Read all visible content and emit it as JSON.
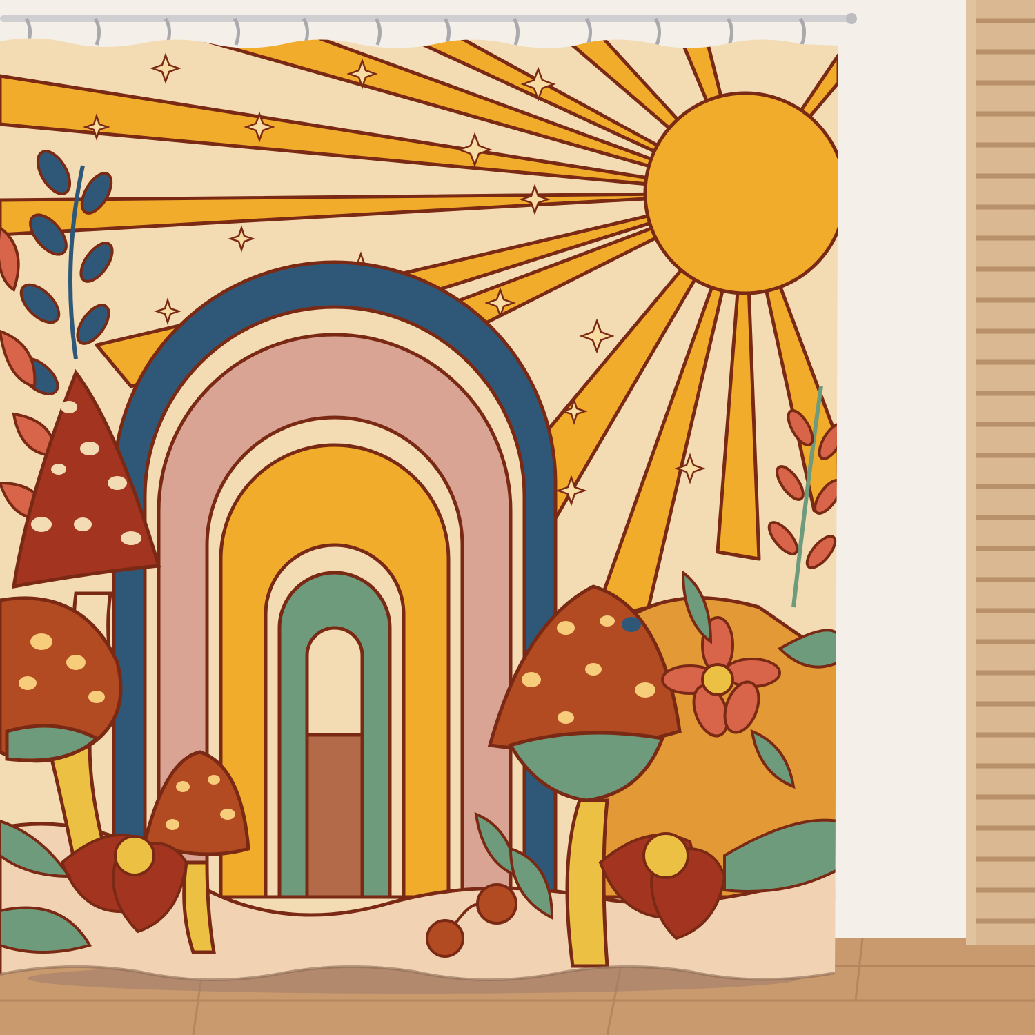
{
  "scene": {
    "subject": "shower-curtain",
    "motif": [
      "sun",
      "rainbow",
      "mushrooms",
      "flowers",
      "leaves",
      "sparkle-stars"
    ],
    "colors": {
      "wall": "#f4efe9",
      "floor": "#c99a6e",
      "floor_dark": "#a97a52",
      "window_frame": "#d9b892",
      "blind": "#e8cda8",
      "curtain_cream": "#f3dcb4",
      "mustard": "#f1ac2c",
      "outline": "#7a2a14",
      "navy": "#2f5878",
      "pink": "#d9a494",
      "sage": "#6e9b7c",
      "rust": "#b24a22",
      "red": "#a3341f",
      "coral": "#d8654a",
      "yellow": "#ecc042",
      "brown": "#b26a49"
    }
  }
}
